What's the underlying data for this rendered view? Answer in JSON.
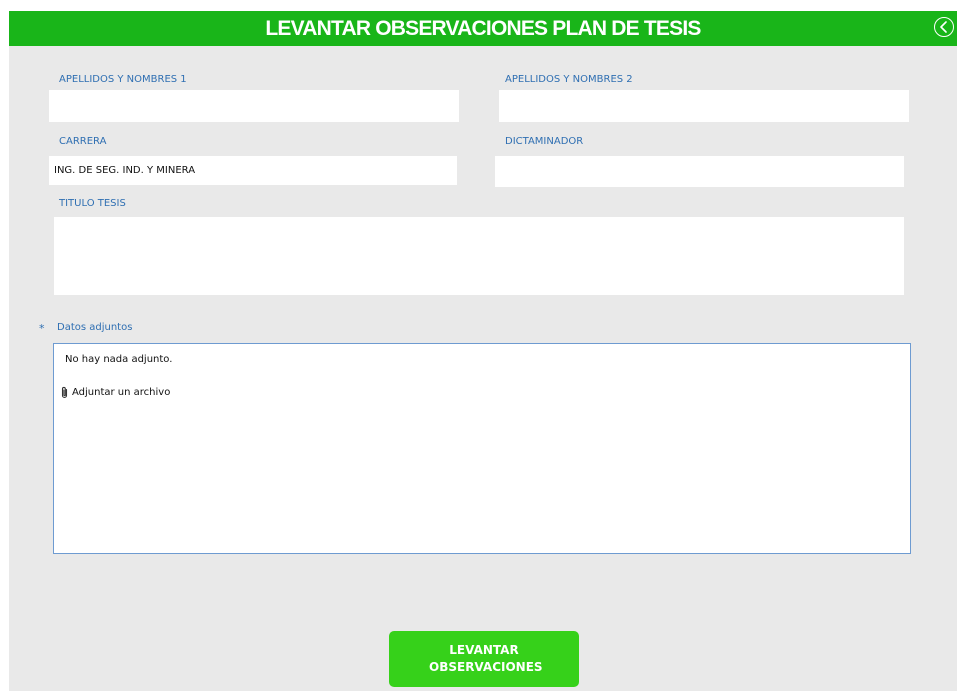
{
  "header": {
    "title": "LEVANTAR OBSERVACIONES PLAN DE TESIS"
  },
  "form": {
    "apellidos1": {
      "label": "APELLIDOS Y NOMBRES 1",
      "value": ""
    },
    "apellidos2": {
      "label": "APELLIDOS Y NOMBRES 2",
      "value": ""
    },
    "carrera": {
      "label": "CARRERA",
      "value": "ING. DE SEG. IND. Y MINERA"
    },
    "dictaminador": {
      "label": "DICTAMINADOR",
      "value": ""
    },
    "titulo": {
      "label": "TITULO TESIS",
      "value": ""
    }
  },
  "attachments": {
    "required_mark": "*",
    "label": "Datos adjuntos",
    "empty_text": "No hay nada adjunto.",
    "attach_link": "Adjuntar un archivo"
  },
  "submit": {
    "label": "LEVANTAR OBSERVACIONES"
  },
  "colors": {
    "header_green": "#19b519",
    "button_green": "#36d11a",
    "label_blue": "#2f6fb2",
    "panel_gray": "#e9e9e9"
  },
  "icons": {
    "back": "chevron-left-circle-icon",
    "attach": "paperclip-icon"
  }
}
